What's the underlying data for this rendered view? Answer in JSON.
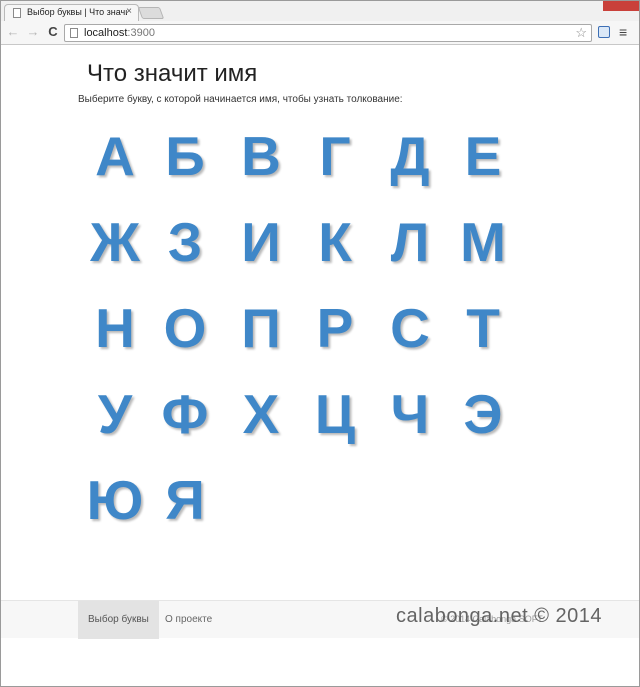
{
  "browser": {
    "tab_title": "Выбор буквы | Что значит имя",
    "tab_close": "×",
    "url_host": "localhost",
    "url_port": ":3900",
    "nav_back": "←",
    "nav_forward": "→",
    "nav_reload": "C",
    "star": "☆",
    "menu": "≡"
  },
  "page": {
    "heading": "Что значит имя",
    "subtitle": "Выберите букву, с которой начинается имя, чтобы узнать толкование:",
    "letters": [
      "А",
      "Б",
      "В",
      "Г",
      "Д",
      "Е",
      "Ж",
      "З",
      "И",
      "К",
      "Л",
      "М",
      "Н",
      "О",
      "П",
      "Р",
      "С",
      "Т",
      "У",
      "Ф",
      "Х",
      "Ц",
      "Ч",
      "Э",
      "Ю",
      "Я"
    ],
    "letter_color": "#3f87c8"
  },
  "footer": {
    "nav_items": [
      "Выбор буквы",
      "О проекте"
    ],
    "active_item": "Выбор буквы",
    "copyright": "© 2014 Calabonga SOFT"
  },
  "watermark": "calabonga.net © 2014"
}
